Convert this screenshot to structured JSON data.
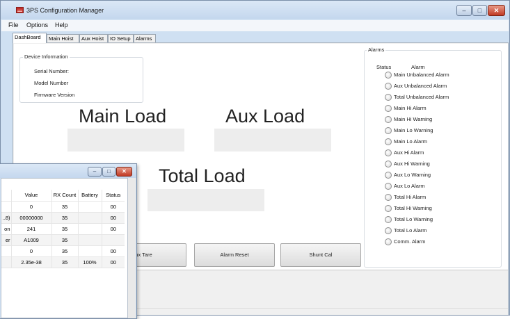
{
  "window": {
    "title": "3PS Configuration Manager",
    "minimize": "–",
    "maximize": "□",
    "close": "✕"
  },
  "menu": {
    "file": "File",
    "options": "Options",
    "help": "Help"
  },
  "tabs": [
    "DashBoard",
    "Main Hoist",
    "Aux Hoist",
    "IO Setup",
    "Alarms"
  ],
  "device_info": {
    "legend": "Device Information",
    "serial": "Serial Number:",
    "model": "Model Number",
    "firmware": "Firmware Version"
  },
  "loads": {
    "main": "Main Load",
    "aux": "Aux Load",
    "total": "Total Load"
  },
  "buttons": {
    "aux_tare": "Aux Tare",
    "alarm_reset": "Alarm Reset",
    "shunt_cal": "Shunt Cal"
  },
  "alarms": {
    "legend": "Alarms",
    "status_head": "Status",
    "alarm_head": "Alarm",
    "items": [
      "Main Unbalanced Alarm",
      "Aux Unbalanced Alarm",
      "Total Unbalanced Alarm",
      "Main Hi Alarm",
      "Main Hi Warning",
      "Main Lo Warning",
      "Main Lo Alarm",
      "Aux Hi Alarm",
      "Aux Hi Warning",
      "Aux Lo Warning",
      "Aux Lo Alarm",
      "Total Hi Alarm",
      "Total Hi Warning",
      "Total Lo Warning",
      "Total Lo Alarm",
      "Comm. Alarm"
    ]
  },
  "sub_window": {
    "minimize": "–",
    "maximize": "□",
    "close": "✕",
    "columns": [
      "",
      "Value",
      "RX Count",
      "Battery",
      "Status"
    ],
    "rows": [
      [
        "",
        "0",
        "35",
        "",
        "00"
      ],
      [
        "..8)",
        "00000000",
        "35",
        "",
        "00"
      ],
      [
        "on",
        "241",
        "35",
        "",
        "00"
      ],
      [
        "er",
        "A1009",
        "35",
        "",
        ""
      ],
      [
        "",
        "0",
        "35",
        "",
        "00"
      ],
      [
        "",
        "2.35e-38",
        "35",
        "100%",
        "00"
      ]
    ]
  }
}
